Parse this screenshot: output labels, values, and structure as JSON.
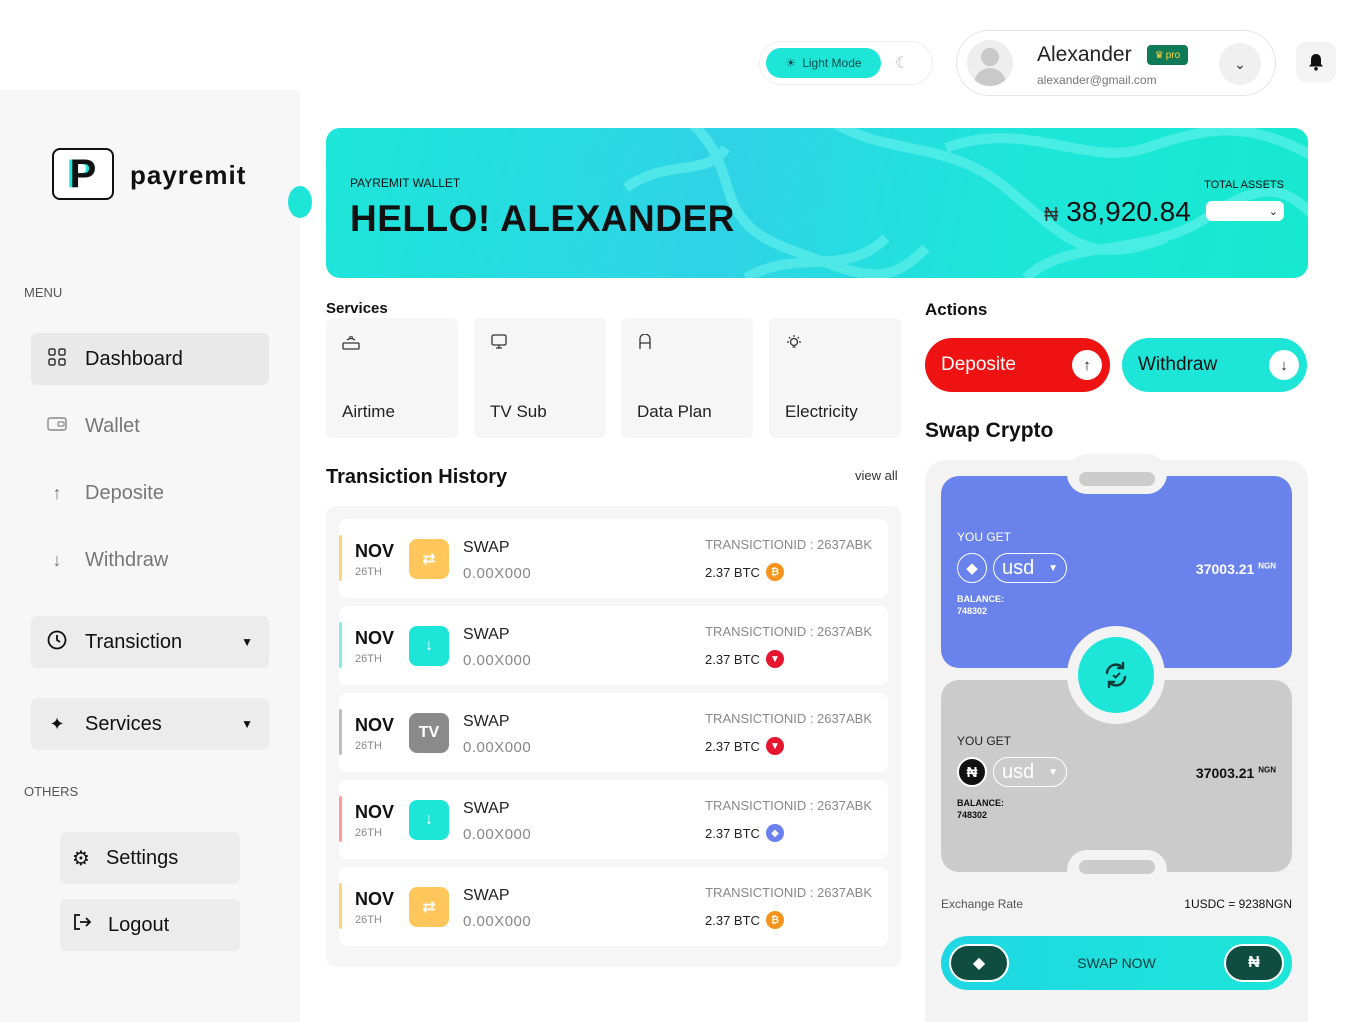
{
  "topbar": {
    "mode_label": "Light Mode",
    "user_name": "Alexander",
    "badge": "pro",
    "user_email": "alexander@gmail.com"
  },
  "brand": {
    "logo_letter": "P",
    "name": "payremit"
  },
  "sidebar": {
    "menu_label": "MENU",
    "others_label": "OTHERS",
    "items": [
      {
        "label": "Dashboard",
        "icon": "grid-icon"
      },
      {
        "label": "Wallet",
        "icon": "wallet-icon"
      },
      {
        "label": "Deposite",
        "icon": "arrow-up-icon"
      },
      {
        "label": "Withdraw",
        "icon": "arrow-down-icon"
      },
      {
        "label": "Transiction",
        "icon": "clock-icon"
      },
      {
        "label": "Services",
        "icon": "sparkle-icon"
      }
    ],
    "others": [
      {
        "label": "Settings",
        "icon": "gear-icon"
      },
      {
        "label": "Logout",
        "icon": "logout-icon"
      }
    ]
  },
  "hero": {
    "subtitle": "PAYREMIT WALLET",
    "title": "HELLO! ALEXANDER",
    "total_label": "TOTAL ASSETS",
    "currency_symbol": "₦",
    "amount": "38,920.84"
  },
  "services": {
    "title": "Services",
    "items": [
      {
        "label": "Airtime",
        "icon": "router-icon"
      },
      {
        "label": "TV Sub",
        "icon": "monitor-icon"
      },
      {
        "label": "Data Plan",
        "icon": "data-icon"
      },
      {
        "label": "Electricity",
        "icon": "bulb-icon"
      }
    ]
  },
  "history": {
    "title": "Transiction History",
    "view_all": "view all",
    "rows": [
      {
        "month": "NOV",
        "day": "26TH",
        "type": "SWAP",
        "sub": "0.00X000",
        "tid": "TRANSICTIONID : 2637ABK",
        "amount": "2.37 BTC",
        "accent": "#ffd27a",
        "icon_bg": "#ffc65c",
        "icon": "⇄",
        "coin_color": "#f7931a",
        "coin": "₿"
      },
      {
        "month": "NOV",
        "day": "26TH",
        "type": "SWAP",
        "sub": "0.00X000",
        "tid": "TRANSICTIONID : 2637ABK",
        "amount": "2.37 BTC",
        "accent": "#7ff0ea",
        "icon_bg": "#1de6d9",
        "icon": "↓",
        "coin_color": "#e5142f",
        "coin": "▼"
      },
      {
        "month": "NOV",
        "day": "26TH",
        "type": "SWAP",
        "sub": "0.00X000",
        "tid": "TRANSICTIONID : 2637ABK",
        "amount": "2.37 BTC",
        "accent": "#bdbdbd",
        "icon_bg": "#8a8a8a",
        "icon": "TV",
        "coin_color": "#e5142f",
        "coin": "▼"
      },
      {
        "month": "NOV",
        "day": "26TH",
        "type": "SWAP",
        "sub": "0.00X000",
        "tid": "TRANSICTIONID : 2637ABK",
        "amount": "2.37 BTC",
        "accent": "#ff9b9b",
        "icon_bg": "#1de6d9",
        "icon": "↓",
        "coin_color": "#6a7ff0",
        "coin": "◆"
      },
      {
        "month": "NOV",
        "day": "26TH",
        "type": "SWAP",
        "sub": "0.00X000",
        "tid": "TRANSICTIONID : 2637ABK",
        "amount": "2.37 BTC",
        "accent": "#ffd27a",
        "icon_bg": "#ffc65c",
        "icon": "⇄",
        "coin_color": "#f7931a",
        "coin": "₿"
      }
    ]
  },
  "actions": {
    "title": "Actions",
    "deposit_label": "Deposite",
    "withdraw_label": "Withdraw",
    "deposit_color": "#ee1212",
    "withdraw_color": "#1de6d9"
  },
  "swap": {
    "title": "Swap Crypto",
    "top": {
      "label": "YOU GET",
      "currency": "usd",
      "value": "37003.21",
      "unit": "NGN",
      "balance_label": "BALANCE:",
      "balance": "748302",
      "color": "#6a82ec"
    },
    "bottom": {
      "label": "YOU GET",
      "currency": "usd",
      "value": "37003.21",
      "unit": "NGN",
      "balance_label": "BALANCE:",
      "balance": "748302",
      "color": "#cbcbcb"
    },
    "rate_label": "Exchange Rate",
    "rate_value": "1USDC = 9238NGN",
    "button_label": "SWAP NOW",
    "naira_symbol": "₦"
  }
}
